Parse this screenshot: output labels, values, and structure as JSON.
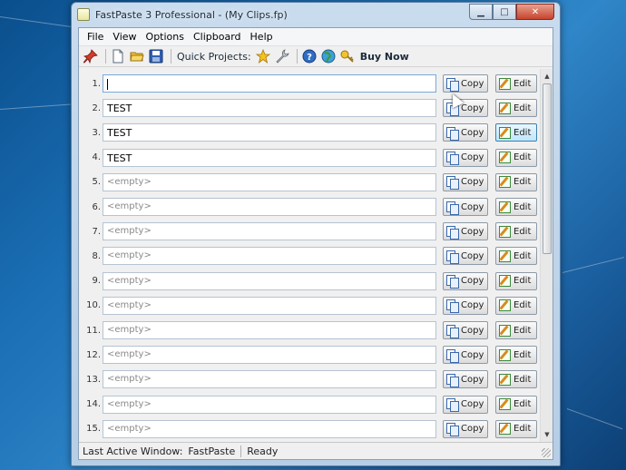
{
  "window": {
    "title": "FastPaste 3 Professional -  (My Clips.fp)",
    "caption_minimize": "▁",
    "caption_maximize": "□",
    "caption_close": "✕"
  },
  "menu": [
    "File",
    "View",
    "Options",
    "Clipboard",
    "Help"
  ],
  "toolbar": {
    "quick_projects_label": "Quick Projects:",
    "buy_now_label": "Buy Now",
    "icons": [
      "pin-icon",
      "new-file-icon",
      "open-folder-icon",
      "save-icon",
      "star-icon",
      "wrench-icon",
      "help-icon",
      "globe-icon",
      "key-icon"
    ]
  },
  "clips": [
    {
      "num": "1.",
      "value": "",
      "empty": false,
      "active": true
    },
    {
      "num": "2.",
      "value": "TEST",
      "empty": false
    },
    {
      "num": "3.",
      "value": "TEST",
      "empty": false
    },
    {
      "num": "4.",
      "value": "TEST",
      "empty": false
    },
    {
      "num": "5.",
      "value": "<empty>",
      "empty": true
    },
    {
      "num": "6.",
      "value": "<empty>",
      "empty": true
    },
    {
      "num": "7.",
      "value": "<empty>",
      "empty": true
    },
    {
      "num": "8.",
      "value": "<empty>",
      "empty": true
    },
    {
      "num": "9.",
      "value": "<empty>",
      "empty": true
    },
    {
      "num": "10.",
      "value": "<empty>",
      "empty": true
    },
    {
      "num": "11.",
      "value": "<empty>",
      "empty": true
    },
    {
      "num": "12.",
      "value": "<empty>",
      "empty": true
    },
    {
      "num": "13.",
      "value": "<empty>",
      "empty": true
    },
    {
      "num": "14.",
      "value": "<empty>",
      "empty": true
    },
    {
      "num": "15.",
      "value": "<empty>",
      "empty": true
    }
  ],
  "buttons": {
    "copy_label": "Copy",
    "edit_label": "Edit"
  },
  "status": {
    "last_active_label": "Last Active Window:",
    "last_active_value": "FastPaste",
    "state": "Ready"
  }
}
